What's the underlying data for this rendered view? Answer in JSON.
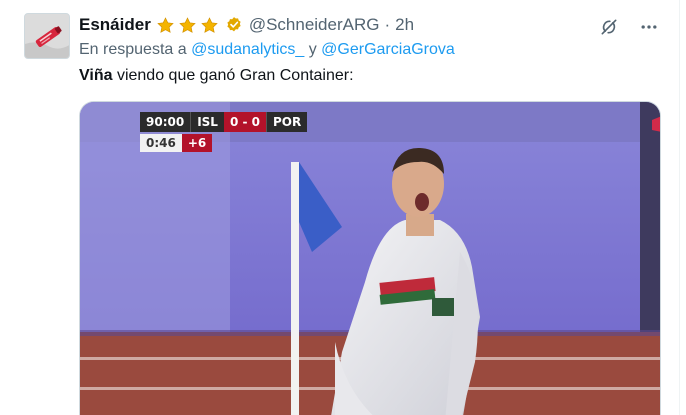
{
  "tweet": {
    "display_name": "Esnáider",
    "handle": "@SchneiderARG",
    "separator": "·",
    "time": "2h",
    "reply_prefix": "En respuesta a",
    "reply_user_1": "@sudanalytics_",
    "reply_joiner": "y",
    "reply_user_2": "@GerGarciaGrova",
    "text_bold": "Viña",
    "text_rest": " viendo que ganó Gran Container:"
  },
  "icons": {
    "badges": [
      "star-icon",
      "star-icon",
      "star-icon",
      "verified-icon"
    ],
    "actions": [
      "grok-icon",
      "more-icon"
    ]
  },
  "scoreboard": {
    "match_time": "90:00",
    "home_team": "ISL",
    "score": "0 - 0",
    "away_team": "POR",
    "clock": "0:46",
    "added_time": "+6"
  },
  "colors": {
    "link": "#1d9bf0",
    "secondary_text": "#536471",
    "star": "#f4b400",
    "verified": "#e2a800",
    "score_red": "#b3122a"
  }
}
